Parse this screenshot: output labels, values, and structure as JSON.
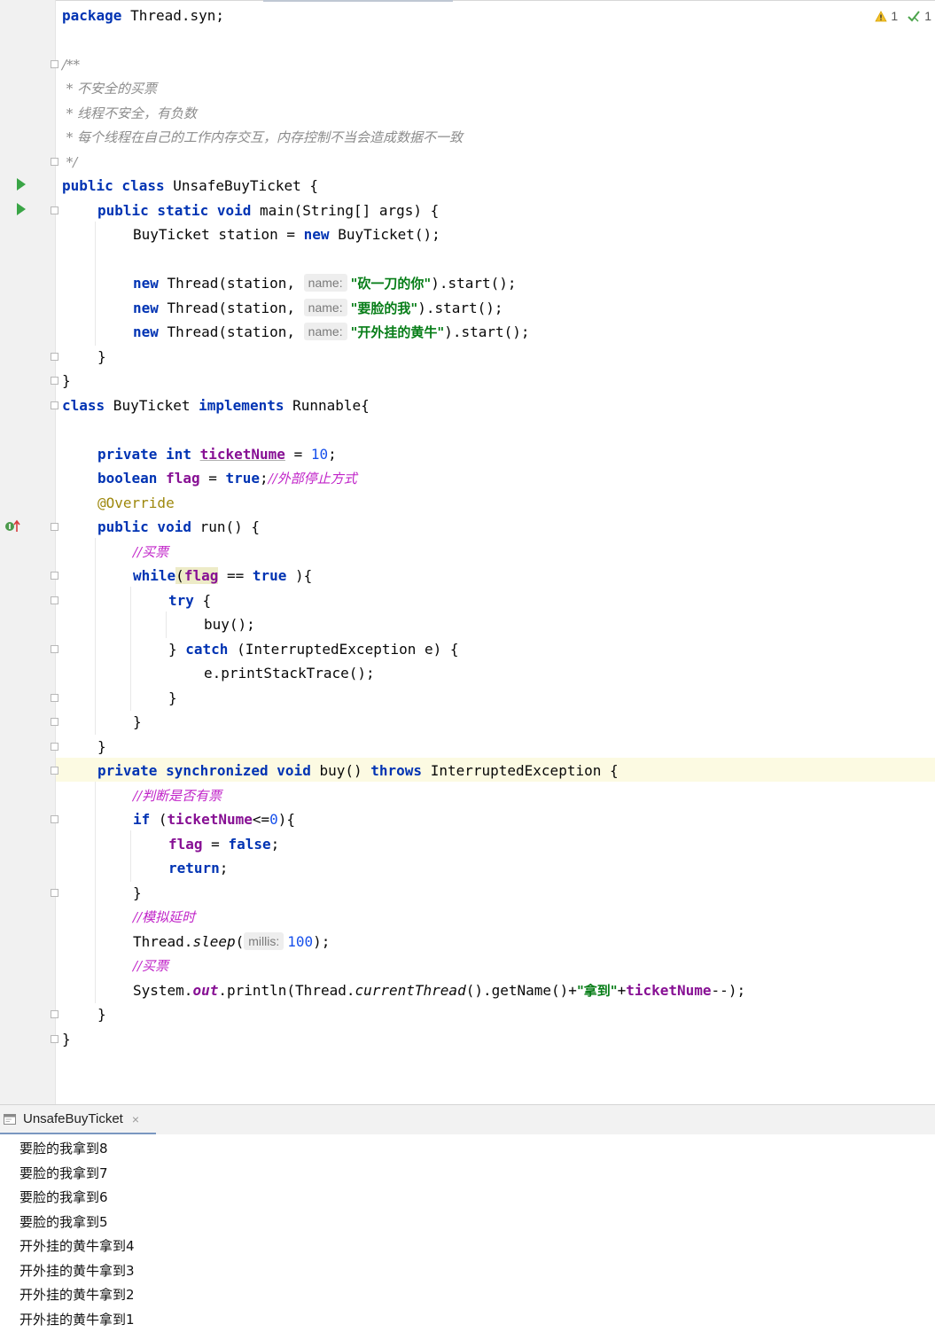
{
  "inspections": {
    "warnings": "1",
    "checks": "1"
  },
  "code": {
    "l1": {
      "kw": "package",
      "rest": " Thread.syn;"
    },
    "l3": {
      "text": "/**"
    },
    "l4": {
      "text": " * 不安全的买票"
    },
    "l5": {
      "text": " * 线程不安全，有负数"
    },
    "l6": {
      "text": " * 每个线程在自己的工作内存交互，内存控制不当会造成数据不一致"
    },
    "l7": {
      "text": " */"
    },
    "l8": {
      "kw": "public class",
      "rest": " UnsafeBuyTicket {"
    },
    "l9": {
      "kw": "public static void",
      "rest": " main(String[] args) {"
    },
    "l10": {
      "pre": "BuyTicket station = ",
      "kw": "new",
      "rest": " BuyTicket();"
    },
    "l12": {
      "kw": "new",
      "pre": " Thread(station, ",
      "hint": "name:",
      "str": "\"砍一刀的你\"",
      "rest": ").start();"
    },
    "l13": {
      "kw": "new",
      "pre": " Thread(station, ",
      "hint": "name:",
      "str": "\"要脸的我\"",
      "rest": ").start();"
    },
    "l14": {
      "kw": "new",
      "pre": " Thread(station, ",
      "hint": "name:",
      "str": "\"开外挂的黄牛\"",
      "rest": ").start();"
    },
    "l15": {
      "text": "}"
    },
    "l16": {
      "text": "}"
    },
    "l17": {
      "kw1": "class",
      "mid": " BuyTicket ",
      "kw2": "implements",
      "rest": " Runnable{"
    },
    "l19": {
      "kw": "private int",
      "fld": "ticketNume",
      "eq": " = ",
      "num": "10",
      "rest": ";"
    },
    "l20": {
      "kw": "boolean",
      "fld": "flag",
      "eq": " = ",
      "kw2": "true",
      "semi": ";",
      "cmt": "//外部停止方式"
    },
    "l21": {
      "ann": "@Override"
    },
    "l22": {
      "kw": "public void",
      "rest": " run() {"
    },
    "l23": {
      "cmt": "//买票"
    },
    "l24": {
      "kw": "while",
      "open": "(",
      "fld": "flag",
      "op": " == ",
      "kw2": "true",
      "rest": " ){"
    },
    "l25": {
      "kw": "try",
      "rest": " {"
    },
    "l26": {
      "text": "buy();"
    },
    "l27": {
      "pre": "} ",
      "kw": "catch",
      "rest": " (InterruptedException e) {"
    },
    "l28": {
      "text": "e.printStackTrace();"
    },
    "l29": {
      "text": "}"
    },
    "l30": {
      "text": "}"
    },
    "l31": {
      "text": "}"
    },
    "l32": {
      "kw": "private synchronized void",
      "mid": " buy() ",
      "kw2": "throws",
      "rest": " InterruptedException {"
    },
    "l33": {
      "cmt": "//判断是否有票"
    },
    "l34": {
      "kw": "if",
      "open": " (",
      "fld": "ticketNume",
      "op": "<=",
      "num": "0",
      "rest": "){"
    },
    "l35": {
      "fld": "flag",
      "eq": " = ",
      "kw": "false",
      "rest": ";"
    },
    "l36": {
      "kw": "return",
      "rest": ";"
    },
    "l37": {
      "text": "}"
    },
    "l38": {
      "cmt": "//模拟延时"
    },
    "l39": {
      "pre": "Thread.",
      "ital": "sleep",
      "open": "(",
      "hint": "millis:",
      "num": "100",
      "rest": ");"
    },
    "l40": {
      "cmt": "//买票"
    },
    "l41": {
      "pre": "System.",
      "static": "out",
      "mid": ".println(Thread.",
      "ital": "currentThread",
      "mid2": "().getName()+",
      "str": "\"拿到\"",
      "plus": "+",
      "fld": "ticketNume",
      "rest": "--);"
    },
    "l42": {
      "text": "}"
    },
    "l43": {
      "text": "}"
    }
  },
  "console": {
    "tab_label": "UnsafeBuyTicket",
    "close": "×",
    "lines": [
      "要脸的我拿到8",
      "要脸的我拿到7",
      "要脸的我拿到6",
      "要脸的我拿到5",
      "开外挂的黄牛拿到4",
      "开外挂的黄牛拿到3",
      "开外挂的黄牛拿到2",
      "开外挂的黄牛拿到1"
    ]
  }
}
